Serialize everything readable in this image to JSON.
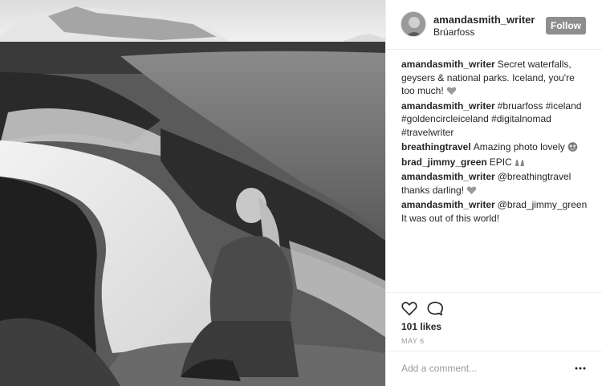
{
  "post": {
    "username": "amandasmith_writer",
    "location": "Brúarfoss",
    "follow_label": "Follow",
    "likes": "101 likes",
    "date": "MAY 6",
    "comment_placeholder": "Add a comment..."
  },
  "comments": [
    {
      "author": "amandasmith_writer",
      "text": "Secret waterfalls, geysers & national parks. Iceland, you're too much!",
      "emoji": "heart-emoji"
    },
    {
      "author": "amandasmith_writer",
      "text": "#bruarfoss #iceland #goldencircleiceland #digitalnomad #travelwriter",
      "emoji": ""
    },
    {
      "author": "breathingtravel",
      "text": "Amazing photo lovely",
      "emoji": "heart-eyes-emoji"
    },
    {
      "author": "brad_jimmy_green",
      "text": "EPIC",
      "emoji": "raised-hands-emoji"
    },
    {
      "author": "amandasmith_writer",
      "text": "@breathingtravel thanks darling!",
      "emoji": "heart-emoji"
    },
    {
      "author": "amandasmith_writer",
      "text": "@brad_jimmy_green It was out of this world!",
      "emoji": ""
    }
  ],
  "icons": {
    "like": "heart-outline-icon",
    "comment": "comment-bubble-icon",
    "more": "more-options-icon"
  },
  "colors": {
    "follow_button": "#8e8e8e",
    "text": "#262626",
    "muted": "#999999",
    "divider": "#efefef"
  }
}
